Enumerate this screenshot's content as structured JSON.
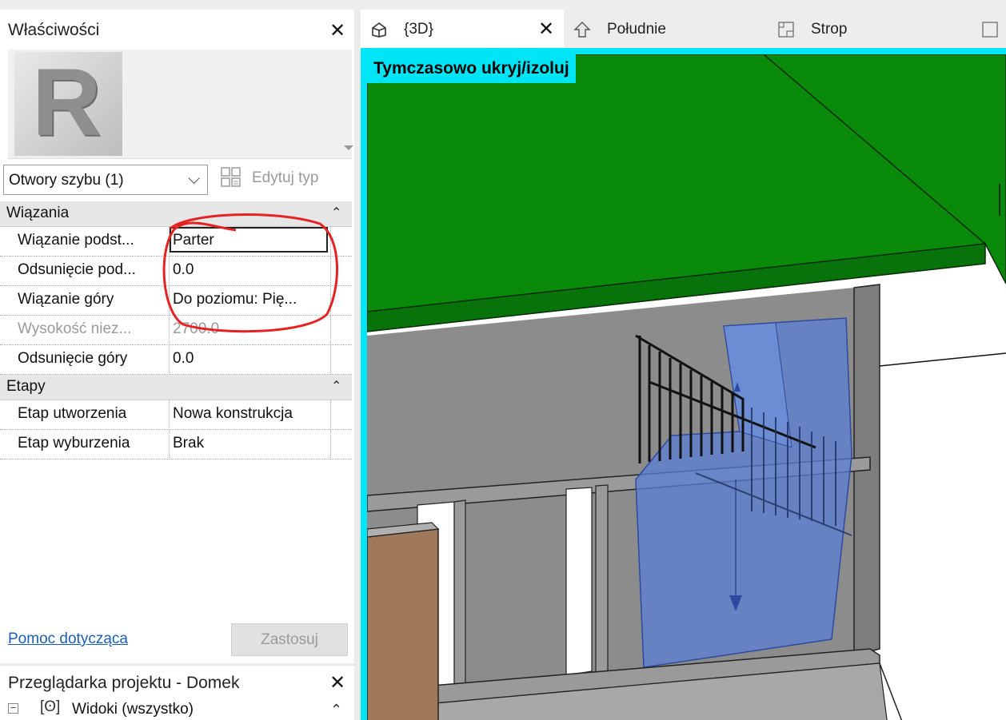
{
  "properties": {
    "title": "Właściwości",
    "type_selector": "Otwory szybu (1)",
    "edit_type_label": "Edytuj typ",
    "groups": [
      {
        "label": "Wiązania",
        "rows": [
          {
            "name": "Wiązanie podst...",
            "value": "Parter"
          },
          {
            "name": "Odsunięcie pod...",
            "value": "0.0"
          },
          {
            "name": "Wiązanie góry",
            "value": "Do poziomu: Pię..."
          },
          {
            "name": "Wysokość niez...",
            "value": "2700.0"
          },
          {
            "name": "Odsunięcie góry",
            "value": "0.0"
          }
        ]
      },
      {
        "label": "Etapy",
        "rows": [
          {
            "name": "Etap utworzenia",
            "value": "Nowa konstrukcja"
          },
          {
            "name": "Etap wyburzenia",
            "value": "Brak"
          }
        ]
      }
    ],
    "help_link": "Pomoc dotycząca",
    "apply_button": "Zastosuj"
  },
  "project_browser": {
    "title": "Przeglądarka projektu - Domek",
    "tree_root": "Widoki (wszystko)"
  },
  "tabs": [
    {
      "label": "{3D}",
      "icon": "3d-view-icon",
      "active": true
    },
    {
      "label": "Południe",
      "icon": "elevation-icon",
      "active": false
    },
    {
      "label": "Strop",
      "icon": "floor-plan-icon",
      "active": false
    }
  ],
  "viewport": {
    "mode_label": "Tymczasowo ukryj/izoluj"
  },
  "colors": {
    "isolate_border": "#00e5f5",
    "roof": "#0a8a0a",
    "wall": "#8c8c8c",
    "shaft_selection": "#5b7fd6",
    "markup_circle": "#e52222"
  }
}
